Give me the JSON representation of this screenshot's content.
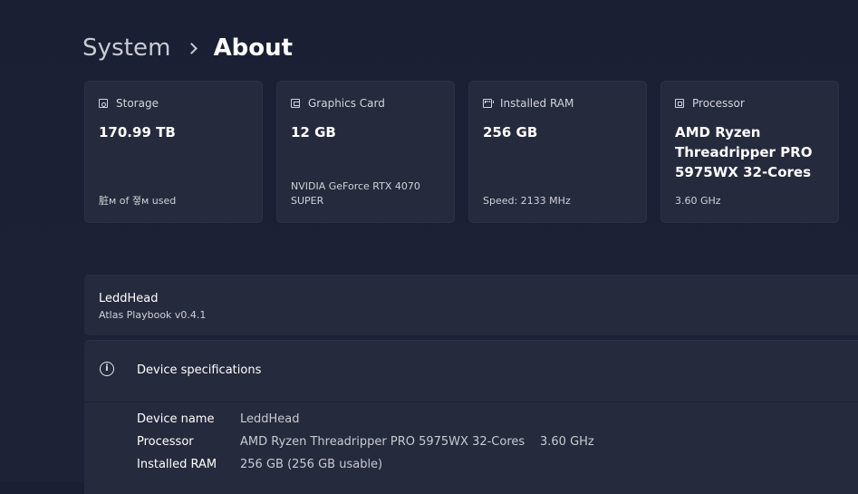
{
  "breadcrumb": {
    "parent": "System",
    "current": "About"
  },
  "cards": [
    {
      "title": "Storage",
      "icon": "storage-icon",
      "value": "170.99 TB",
      "sub": "脏ᴍ of 졓ᴍ used"
    },
    {
      "title": "Graphics Card",
      "icon": "graphics-card-icon",
      "value": "12 GB",
      "sub": "NVIDIA GeForce RTX 4070 SUPER"
    },
    {
      "title": "Installed RAM",
      "icon": "ram-icon",
      "value": "256 GB",
      "sub": "Speed: 2133 MHz"
    },
    {
      "title": "Processor",
      "icon": "processor-icon",
      "value": "AMD Ryzen Threadripper PRO 5975WX 32-Cores",
      "sub": "3.60 GHz"
    }
  ],
  "device": {
    "name": "LeddHead",
    "subtitle": "Atlas Playbook v0.4.1"
  },
  "specs": {
    "title": "Device specifications",
    "rows": [
      {
        "label": "Device name",
        "value": "LeddHead",
        "extra": ""
      },
      {
        "label": "Processor",
        "value": "AMD Ryzen Threadripper PRO 5975WX 32-Cores",
        "extra": "3.60 GHz"
      },
      {
        "label": "Installed RAM",
        "value": "256 GB (256 GB usable)",
        "extra": ""
      }
    ]
  }
}
